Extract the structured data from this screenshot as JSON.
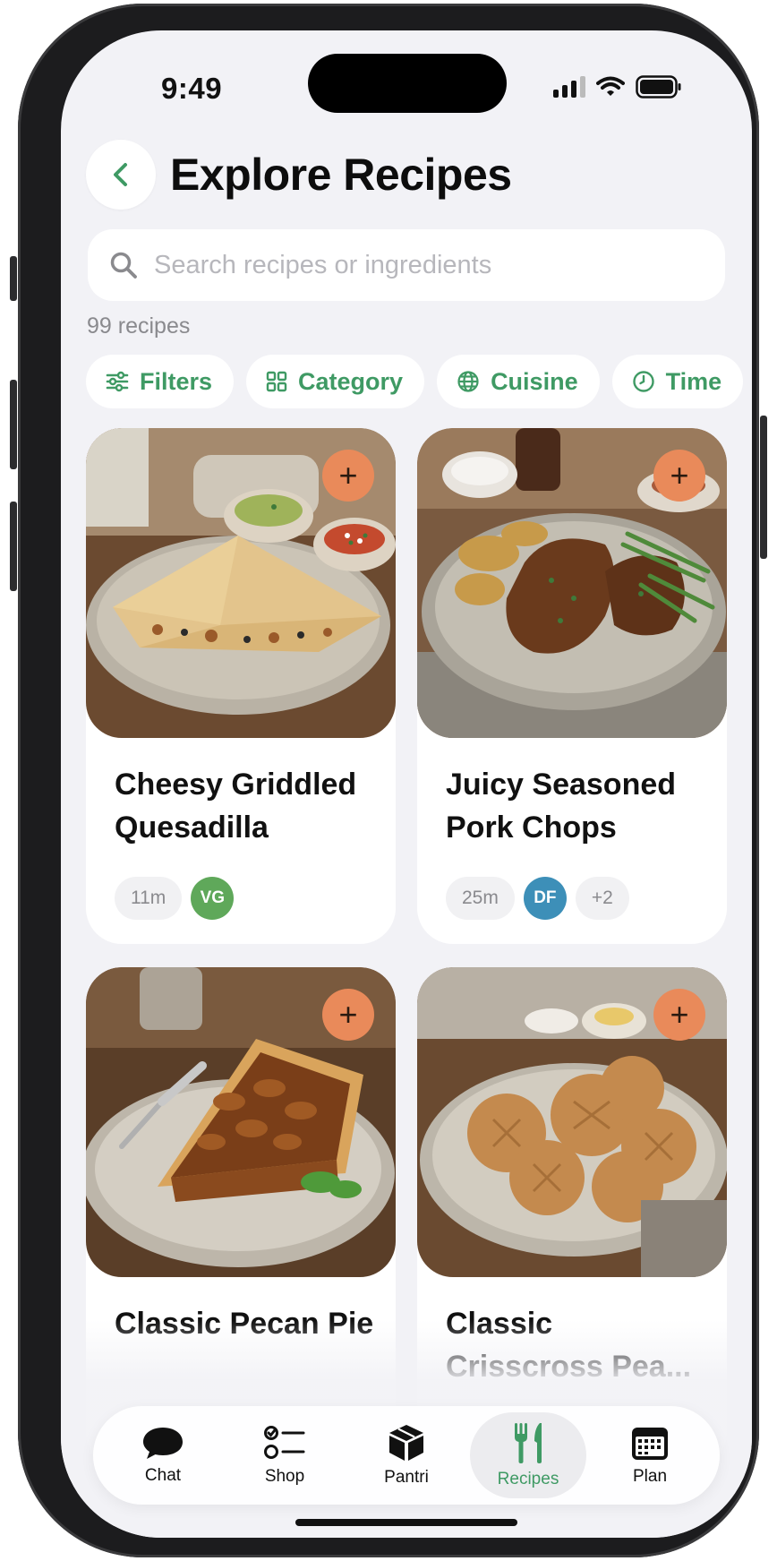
{
  "status_bar": {
    "time": "9:49"
  },
  "header": {
    "title": "Explore Recipes"
  },
  "search": {
    "placeholder": "Search recipes or ingredients"
  },
  "recipe_count": "99 recipes",
  "filters": [
    {
      "label": "Filters",
      "icon": "sliders-icon"
    },
    {
      "label": "Category",
      "icon": "grid-icon"
    },
    {
      "label": "Cuisine",
      "icon": "globe-icon"
    },
    {
      "label": "Time",
      "icon": "clock-icon"
    }
  ],
  "recipes": [
    {
      "title": "Cheesy Griddled Quesadilla",
      "time": "11m",
      "badges": [
        {
          "label": "VG",
          "color": "#5fa85a"
        }
      ],
      "extra": ""
    },
    {
      "title": "Juicy Seasoned Pork Chops",
      "time": "25m",
      "badges": [
        {
          "label": "DF",
          "color": "#3d8fb8"
        }
      ],
      "extra": "+2"
    },
    {
      "title": "Classic Pecan Pie",
      "time": "",
      "badges": [],
      "extra": ""
    },
    {
      "title": "Classic Crisscross Pea...",
      "time": "",
      "badges": [],
      "extra": ""
    }
  ],
  "add_label": "+",
  "tabs": [
    {
      "label": "Chat",
      "icon": "chat-bubble-icon",
      "active": false
    },
    {
      "label": "Shop",
      "icon": "checklist-icon",
      "active": false
    },
    {
      "label": "Pantri",
      "icon": "box-icon",
      "active": false
    },
    {
      "label": "Recipes",
      "icon": "fork-knife-icon",
      "active": true
    },
    {
      "label": "Plan",
      "icon": "calendar-icon",
      "active": false
    }
  ],
  "colors": {
    "accent": "#3f9a64",
    "add_button": "#e98a5a",
    "background": "#f2f2f6"
  }
}
